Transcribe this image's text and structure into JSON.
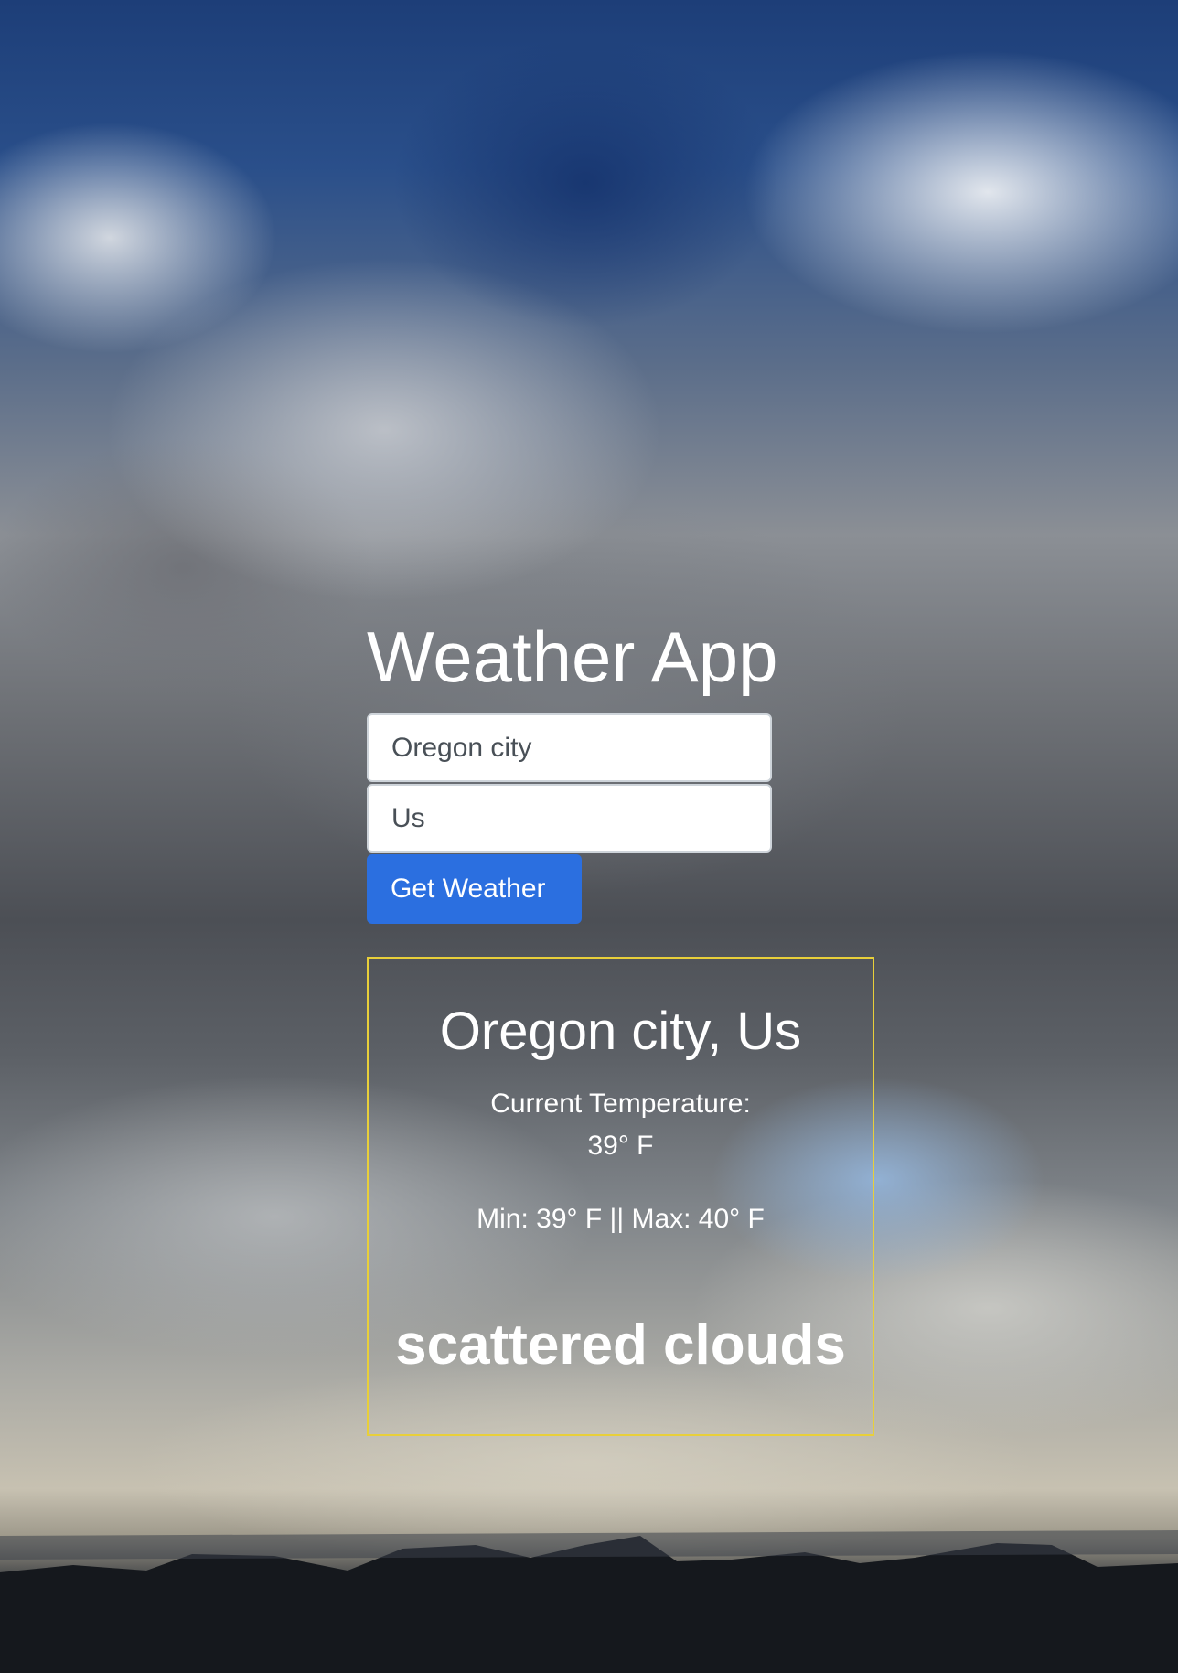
{
  "app": {
    "title": "Weather App"
  },
  "form": {
    "city_value": "Oregon city",
    "country_value": "Us",
    "submit_label": "Get Weather"
  },
  "result": {
    "location": "Oregon city, Us",
    "temperature_label": "Current Temperature:",
    "temperature_value": "39° F",
    "min_max": "Min: 39° F || Max: 40° F",
    "description": "scattered clouds"
  },
  "colors": {
    "button": "#2b6fe0",
    "result_border": "#e8cf3a"
  }
}
